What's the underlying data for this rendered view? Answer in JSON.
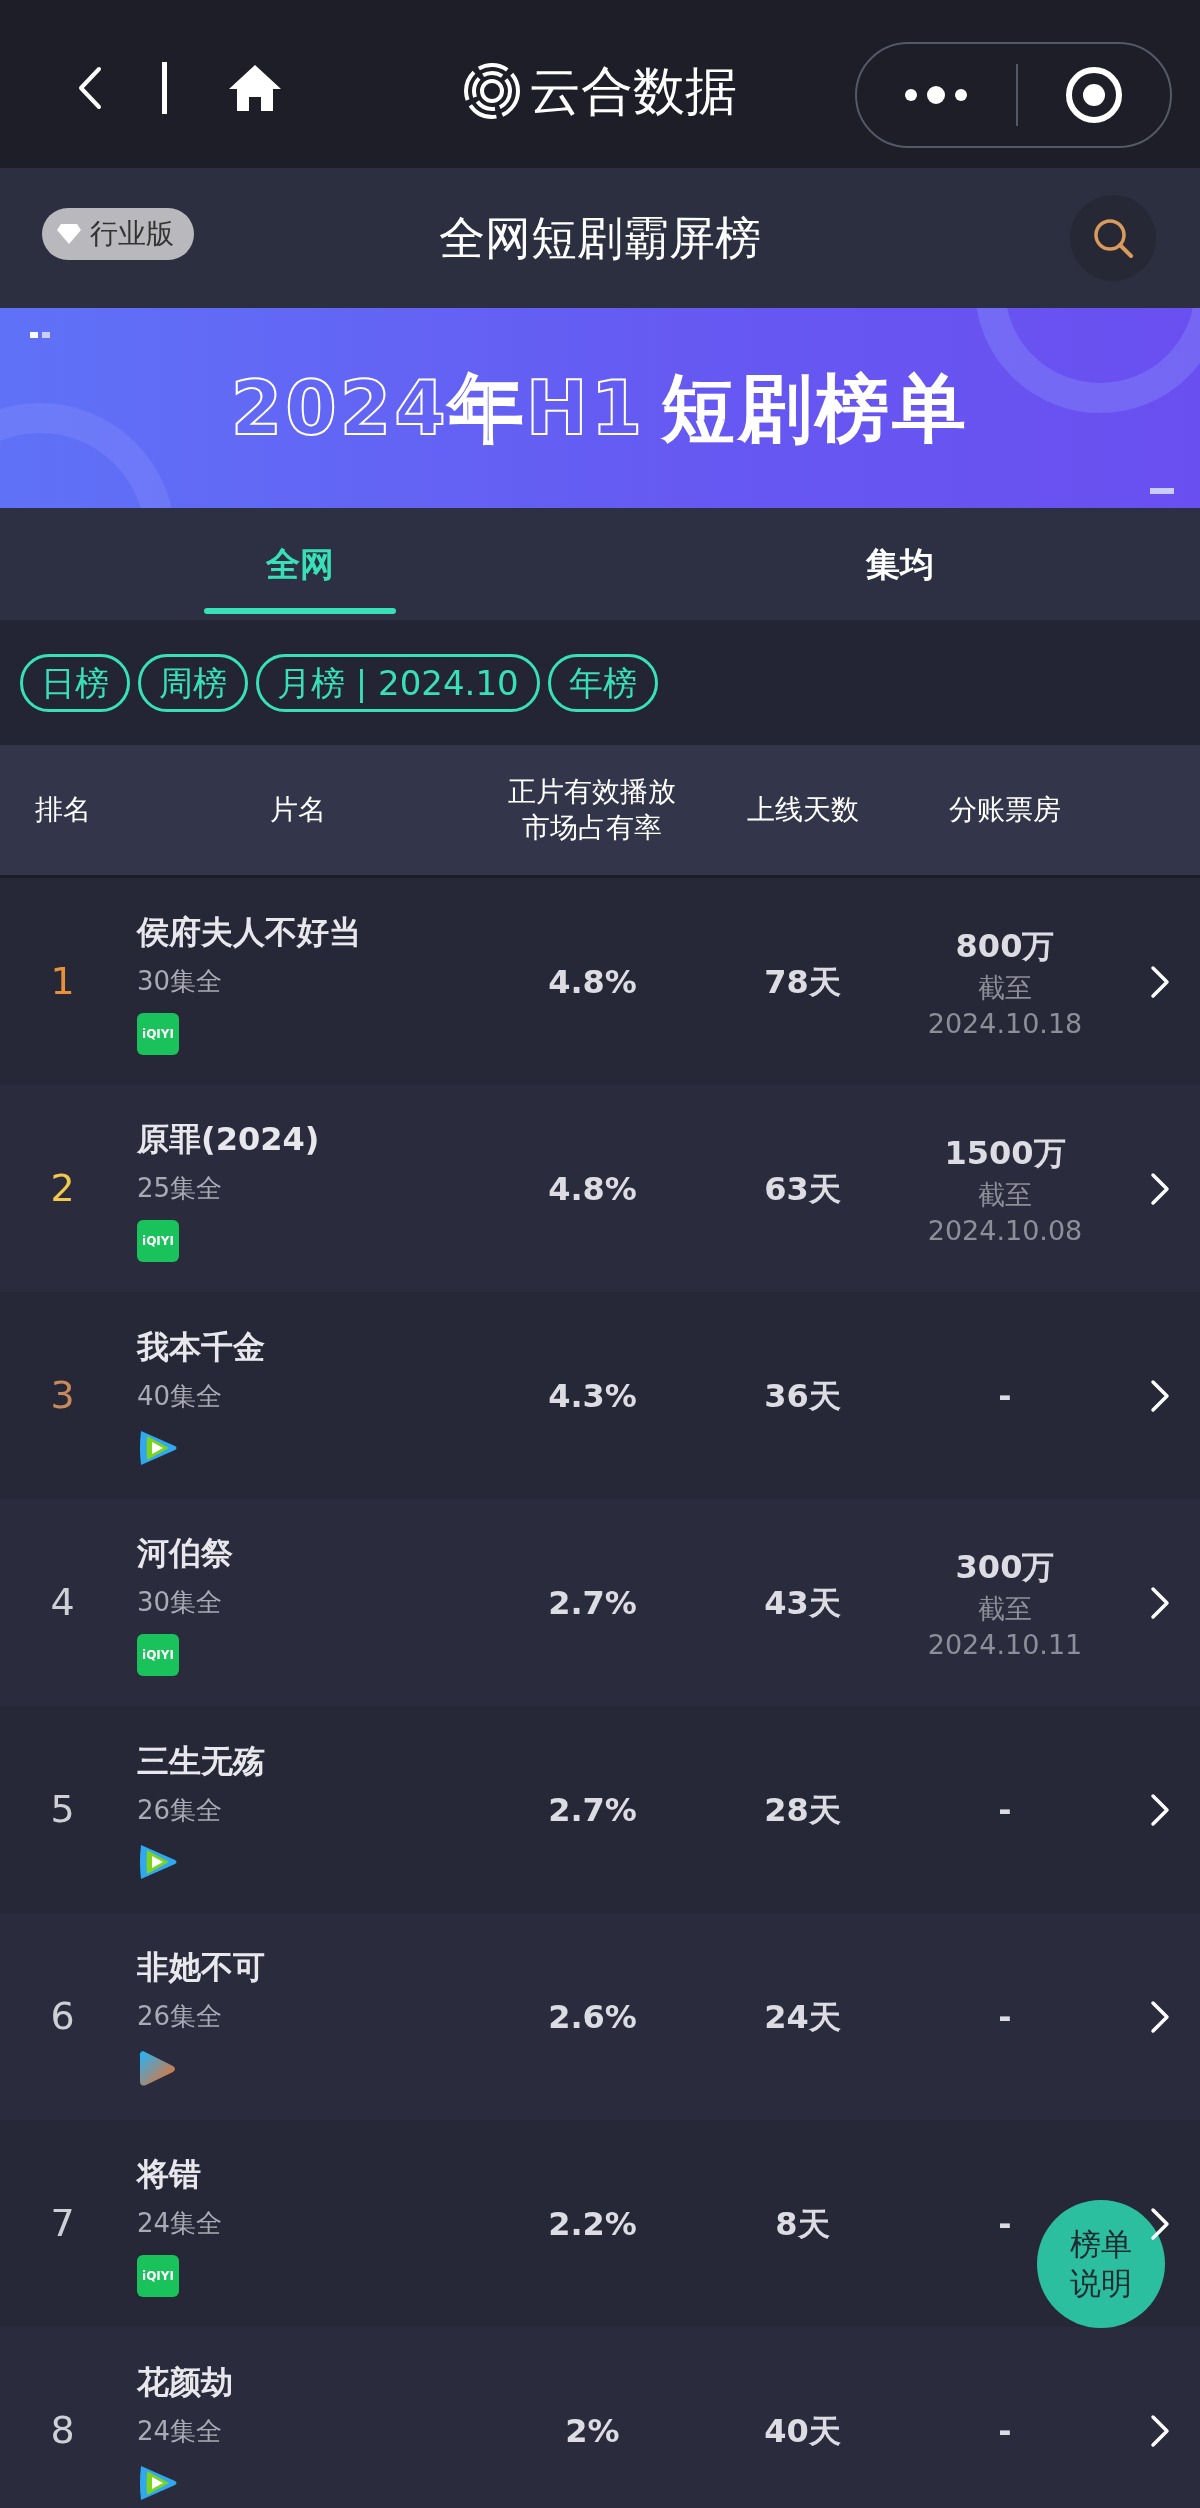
{
  "top_bar": {
    "app_name": "云合数据"
  },
  "header": {
    "badge": "行业版",
    "title": "全网短剧霸屏榜"
  },
  "banner": {
    "outline_text": "2024年H1",
    "bold_text": "短剧榜单"
  },
  "tabs": [
    {
      "label": "全网",
      "selected": true
    },
    {
      "label": "集均",
      "selected": false
    }
  ],
  "periods": [
    "日榜",
    "周榜",
    "月榜 | 2024.10",
    "年榜"
  ],
  "table": {
    "columns": [
      "排名",
      "片名",
      "正片有效播放市场占有率",
      "上线天数",
      "分账票房"
    ],
    "rows": [
      {
        "rank": "1",
        "color": "#e8903a",
        "title": "侯府夫人不好当",
        "episodes": "30集全",
        "platform": {
          "kind": "iqiyi",
          "logo_text": "iQIYI"
        },
        "share": "4.8%",
        "days": "78天",
        "box_office": "800万",
        "box_note": "截至",
        "box_date": "2024.10.18"
      },
      {
        "rank": "2",
        "color": "#f2c94c",
        "title": "原罪(2024)",
        "episodes": "25集全",
        "platform": {
          "kind": "iqiyi",
          "logo_text": "iQIYI"
        },
        "share": "4.8%",
        "days": "63天",
        "box_office": "1500万",
        "box_note": "截至",
        "box_date": "2024.10.08"
      },
      {
        "rank": "3",
        "color": "#c98a5a",
        "title": "我本千金",
        "episodes": "40集全",
        "platform": {
          "kind": "tencent"
        },
        "share": "4.3%",
        "days": "36天",
        "box_office": "-"
      },
      {
        "rank": "4",
        "color": "#cfd0d6",
        "title": "河伯祭",
        "episodes": "30集全",
        "platform": {
          "kind": "iqiyi",
          "logo_text": "iQIYI"
        },
        "share": "2.7%",
        "days": "43天",
        "box_office": "300万",
        "box_note": "截至",
        "box_date": "2024.10.11"
      },
      {
        "rank": "5",
        "color": "#cfd0d6",
        "title": "三生无殇",
        "episodes": "26集全",
        "platform": {
          "kind": "tencent"
        },
        "share": "2.7%",
        "days": "28天",
        "box_office": "-"
      },
      {
        "rank": "6",
        "color": "#cfd0d6",
        "title": "非她不可",
        "episodes": "26集全",
        "platform": {
          "kind": "youku"
        },
        "share": "2.6%",
        "days": "24天",
        "box_office": "-"
      },
      {
        "rank": "7",
        "color": "#cfd0d6",
        "title": "将错",
        "episodes": "24集全",
        "platform": {
          "kind": "iqiyi",
          "logo_text": "iQIYI"
        },
        "share": "2.2%",
        "days": "8天",
        "box_office": "-"
      },
      {
        "rank": "8",
        "color": "#cfd0d6",
        "title": "花颜劫",
        "episodes": "24集全",
        "platform": {
          "kind": "tencent"
        },
        "share": "2%",
        "days": "40天",
        "box_office": "-"
      }
    ]
  },
  "help_button": {
    "label": "榜单说明"
  }
}
